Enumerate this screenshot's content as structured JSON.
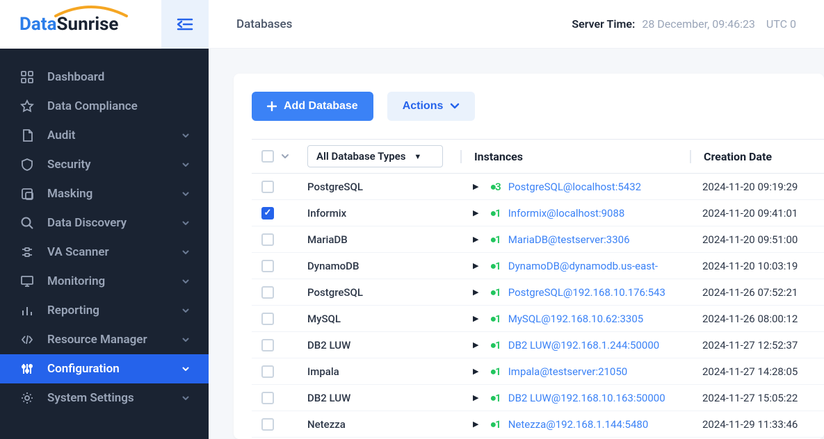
{
  "brand": {
    "part1": "Data",
    "part2": "Sunrise"
  },
  "topbar": {
    "breadcrumb": "Databases",
    "server_time_label": "Server Time:",
    "server_time_value": "28 December, 09:46:23",
    "server_time_tz": "UTC 0"
  },
  "sidebar": {
    "items": [
      {
        "label": "Dashboard",
        "expandable": false
      },
      {
        "label": "Data Compliance",
        "expandable": false
      },
      {
        "label": "Audit",
        "expandable": true
      },
      {
        "label": "Security",
        "expandable": true
      },
      {
        "label": "Masking",
        "expandable": true
      },
      {
        "label": "Data Discovery",
        "expandable": true
      },
      {
        "label": "VA Scanner",
        "expandable": true
      },
      {
        "label": "Monitoring",
        "expandable": true
      },
      {
        "label": "Reporting",
        "expandable": true
      },
      {
        "label": "Resource Manager",
        "expandable": true
      },
      {
        "label": "Configuration",
        "expandable": true
      },
      {
        "label": "System Settings",
        "expandable": true
      }
    ]
  },
  "toolbar": {
    "add_label": "Add Database",
    "actions_label": "Actions"
  },
  "table": {
    "filter_label": "All Database Types",
    "headers": {
      "instances": "Instances",
      "creation_date": "Creation Date"
    },
    "rows": [
      {
        "checked": false,
        "type": "PostgreSQL",
        "count": 3,
        "instance": "PostgreSQL@localhost:5432",
        "date": "2024-11-20 09:19:29"
      },
      {
        "checked": true,
        "type": "Informix",
        "count": 1,
        "instance": "Informix@localhost:9088",
        "date": "2024-11-20 09:41:01"
      },
      {
        "checked": false,
        "type": "MariaDB",
        "count": 1,
        "instance": "MariaDB@testserver:3306",
        "date": "2024-11-20 09:51:00"
      },
      {
        "checked": false,
        "type": "DynamoDB",
        "count": 1,
        "instance": "DynamoDB@dynamodb.us-east-",
        "date": "2024-11-20 10:03:19"
      },
      {
        "checked": false,
        "type": "PostgreSQL",
        "count": 1,
        "instance": "PostgreSQL@192.168.10.176:543",
        "date": "2024-11-26 07:52:21"
      },
      {
        "checked": false,
        "type": "MySQL",
        "count": 1,
        "instance": "MySQL@192.168.10.62:3305",
        "date": "2024-11-26 08:00:12"
      },
      {
        "checked": false,
        "type": "DB2 LUW",
        "count": 1,
        "instance": "DB2 LUW@192.168.1.244:50000",
        "date": "2024-11-27 12:52:37"
      },
      {
        "checked": false,
        "type": "Impala",
        "count": 1,
        "instance": "Impala@testserver:21050",
        "date": "2024-11-27 14:28:05"
      },
      {
        "checked": false,
        "type": "DB2 LUW",
        "count": 1,
        "instance": "DB2 LUW@192.168.10.163:50000",
        "date": "2024-11-27 15:05:22"
      },
      {
        "checked": false,
        "type": "Netezza",
        "count": 1,
        "instance": "Netezza@192.168.1.144:5480",
        "date": "2024-11-29 11:33:46"
      }
    ]
  }
}
